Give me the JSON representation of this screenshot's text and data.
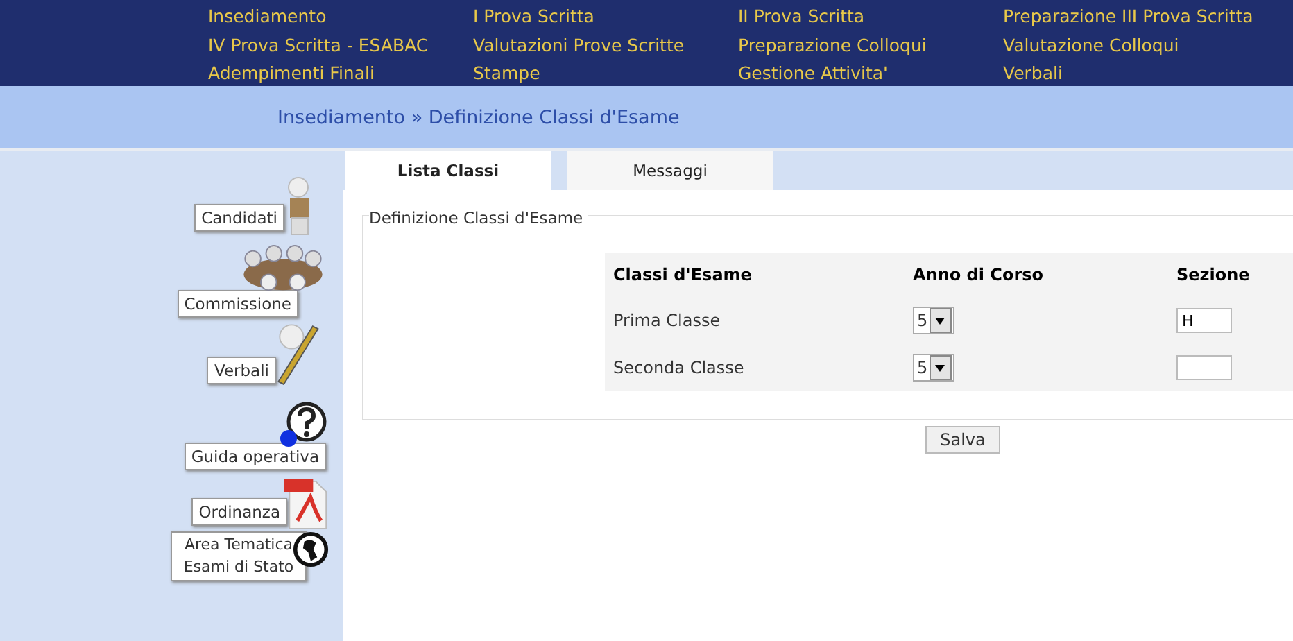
{
  "menu": [
    {
      "label": "Insediamento"
    },
    {
      "label": "I Prova Scritta"
    },
    {
      "label": "II Prova Scritta"
    },
    {
      "label": "Preparazione III Prova Scritta"
    },
    {
      "label": "IV Prova Scritta - ESABAC"
    },
    {
      "label": "Valutazioni Prove Scritte"
    },
    {
      "label": "Preparazione Colloqui"
    },
    {
      "label": "Valutazione Colloqui"
    },
    {
      "label": "Adempimenti Finali"
    },
    {
      "label": "Stampe"
    },
    {
      "label": "Gestione Attivita'"
    },
    {
      "label": "Verbali"
    }
  ],
  "breadcrumb": {
    "parent": "Insediamento",
    "separator": "»",
    "current": "Definizione Classi d'Esame"
  },
  "sidebar": {
    "items": [
      {
        "label": "Candidati",
        "kind": "person"
      },
      {
        "label": "Commissione",
        "kind": "group"
      },
      {
        "label": "Verbali",
        "kind": "pen"
      },
      {
        "label": "Guida operativa",
        "kind": "help"
      },
      {
        "label": "Ordinanza",
        "kind": "pdf"
      },
      {
        "label": "Area Tematica Esami di Stato",
        "kind": "globe"
      }
    ]
  },
  "tabs": [
    {
      "label": "Lista Classi",
      "selected": true
    },
    {
      "label": "Messaggi",
      "selected": false
    }
  ],
  "section": {
    "legend": "Definizione Classi d'Esame",
    "columns": [
      "Classi d'Esame",
      "Anno di Corso",
      "Sezione"
    ],
    "rows": [
      {
        "name": "Prima Classe",
        "anno": "5",
        "sezione": "H"
      },
      {
        "name": "Seconda Classe",
        "anno": "5",
        "sezione": ""
      }
    ]
  },
  "save_button": "Salva"
}
